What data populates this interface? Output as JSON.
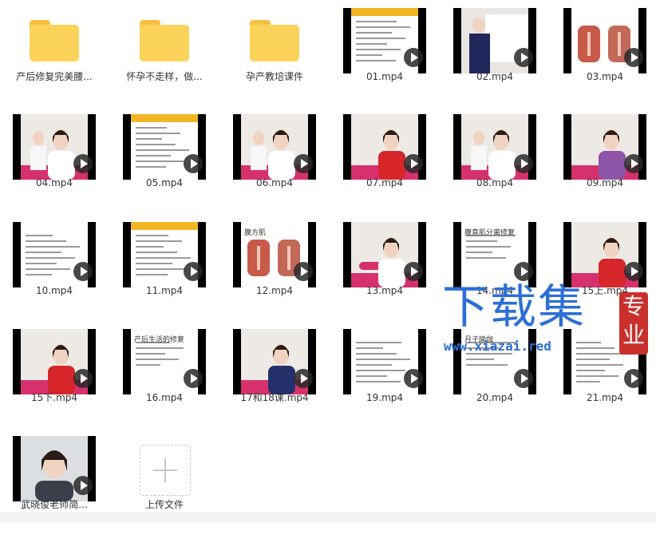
{
  "items": [
    {
      "name": "产后修复完美腰...",
      "kind": "folder"
    },
    {
      "name": "怀孕不走样，做...",
      "kind": "folder"
    },
    {
      "name": "孕产教培课件",
      "kind": "folder"
    },
    {
      "name": "01.mp4",
      "kind": "video",
      "scene": "doc"
    },
    {
      "name": "02.mp4",
      "kind": "video",
      "scene": "whiteboard"
    },
    {
      "name": "03.mp4",
      "kind": "video",
      "scene": "anatomy"
    },
    {
      "name": "04.mp4",
      "kind": "video",
      "scene": "two-people"
    },
    {
      "name": "05.mp4",
      "kind": "video",
      "scene": "doc"
    },
    {
      "name": "06.mp4",
      "kind": "video",
      "scene": "two-people"
    },
    {
      "name": "07.mp4",
      "kind": "video",
      "scene": "person-red"
    },
    {
      "name": "08.mp4",
      "kind": "video",
      "scene": "standing"
    },
    {
      "name": "09.mp4",
      "kind": "video",
      "scene": "person-purple"
    },
    {
      "name": "10.mp4",
      "kind": "video",
      "scene": "doc-plain"
    },
    {
      "name": "11.mp4",
      "kind": "video",
      "scene": "doc"
    },
    {
      "name": "12.mp4",
      "kind": "video",
      "scene": "muscle-slide"
    },
    {
      "name": "13.mp4",
      "kind": "video",
      "scene": "floor-exercise"
    },
    {
      "name": "14.mp4",
      "kind": "video",
      "scene": "slide-text"
    },
    {
      "name": "15上.mp4",
      "kind": "video",
      "scene": "person-red-close"
    },
    {
      "name": "15下.mp4",
      "kind": "video",
      "scene": "person-red"
    },
    {
      "name": "16.mp4",
      "kind": "video",
      "scene": "slide-text"
    },
    {
      "name": "17和18课.mp4",
      "kind": "video",
      "scene": "person-blue"
    },
    {
      "name": "19.mp4",
      "kind": "video",
      "scene": "doc-plain"
    },
    {
      "name": "20.mp4",
      "kind": "video",
      "scene": "slide-text"
    },
    {
      "name": "21.mp4",
      "kind": "video",
      "scene": "doc-plain"
    },
    {
      "name": "武晓俊老师简...",
      "kind": "video",
      "scene": "portrait"
    },
    {
      "name": "上传文件",
      "kind": "upload"
    }
  ],
  "slide_texts": {
    "12": "腹方肌",
    "14": "腹直肌分离修复",
    "16": "产后生活的修复",
    "20": "月子瑜伽"
  },
  "watermark": {
    "title": "下载集",
    "url": "www.xiazai.red",
    "seal": [
      "专",
      "业"
    ]
  },
  "colors": {
    "folder": "#fbd25a",
    "folder_tab": "#f5c041",
    "brand_bar": "#f2b624",
    "mat": "#d6316e",
    "red_shirt": "#d6262a",
    "watermark": "#2c6fd6",
    "seal": "#c9302c"
  }
}
